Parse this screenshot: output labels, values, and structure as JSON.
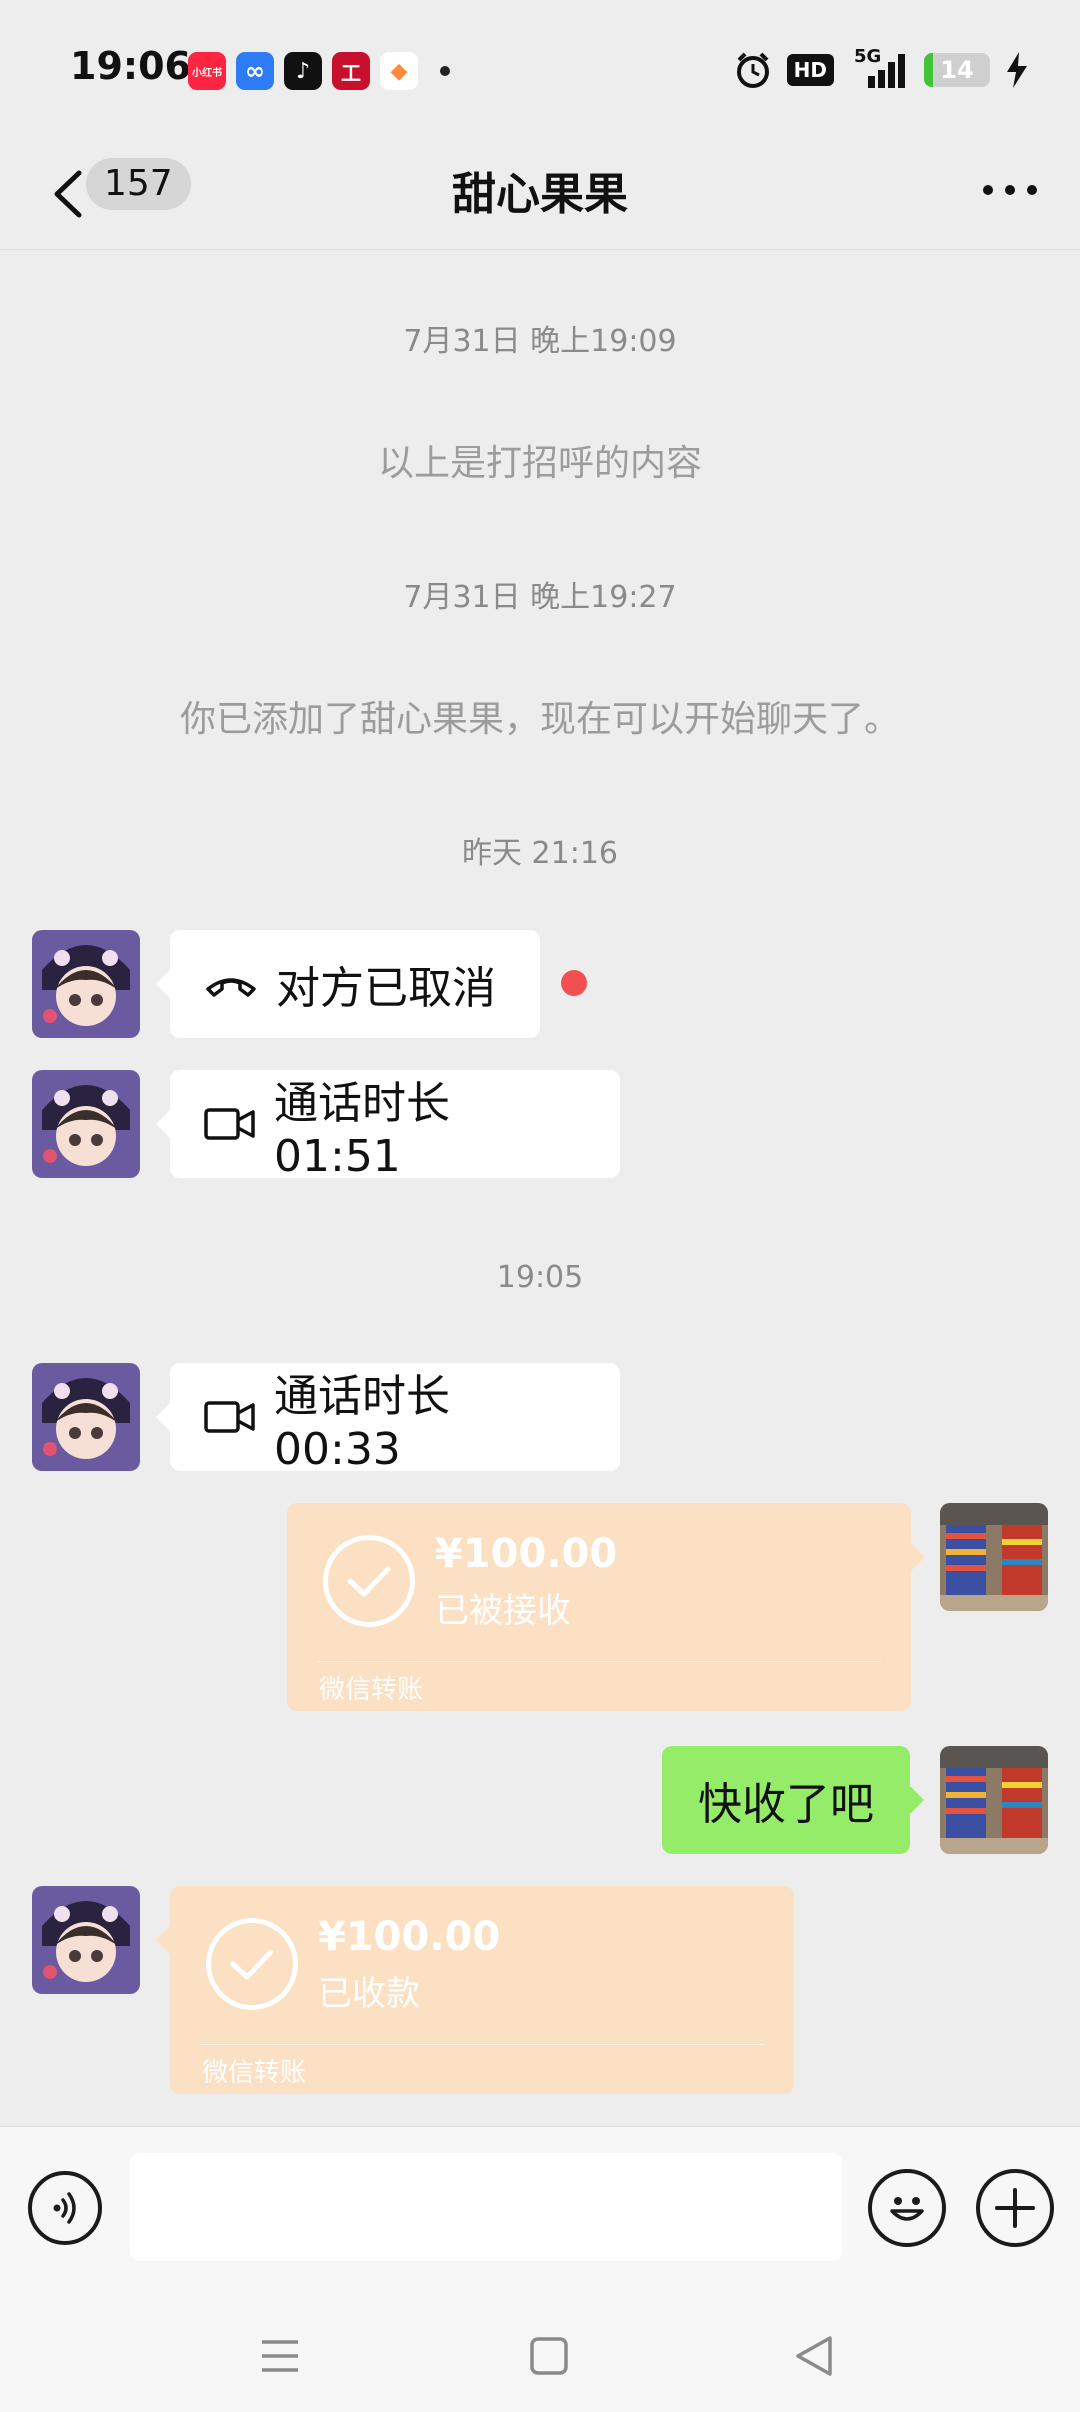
{
  "status_bar": {
    "time": "19:06",
    "app_badges": [
      {
        "name": "xiaohongshu-icon",
        "text": "小红书",
        "color": "#ff2442"
      },
      {
        "name": "cloud-icon",
        "text": "∞",
        "color": "#2d7cf6"
      },
      {
        "name": "tiktok-icon",
        "text": "♪",
        "color": "#111111"
      },
      {
        "name": "bank-icon",
        "text": "工",
        "color": "#c8102e"
      },
      {
        "name": "app-icon",
        "text": "◆",
        "color": "#ff8a3d"
      }
    ],
    "network": "5G",
    "hd": "HD",
    "battery": "14",
    "battery_fraction": 0.14
  },
  "header": {
    "back_count": "157",
    "title": "甜心果果"
  },
  "messages": {
    "t1": "7月31日 晚上19:09",
    "note1": "以上是打招呼的内容",
    "t2": "7月31日 晚上19:27",
    "note2": "你已添加了甜心果果，现在可以开始聊天了。",
    "t3": "昨天 21:16",
    "call_cancelled": "对方已取消",
    "call_duration_1": "通话时长 01:51",
    "t4": "19:05",
    "call_duration_2": "通话时长 00:33",
    "transfer_sent": {
      "amount": "¥100.00",
      "status": "已被接收",
      "label": "微信转账"
    },
    "text_sent": "快收了吧",
    "transfer_received": {
      "amount": "¥100.00",
      "status": "已收款",
      "label": "微信转账"
    }
  },
  "input": {
    "placeholder": ""
  },
  "colors": {
    "background": "#ededed",
    "green_bubble": "#95ec69",
    "transfer_bg": "#fce0c3",
    "unread_dot": "#f25050"
  }
}
